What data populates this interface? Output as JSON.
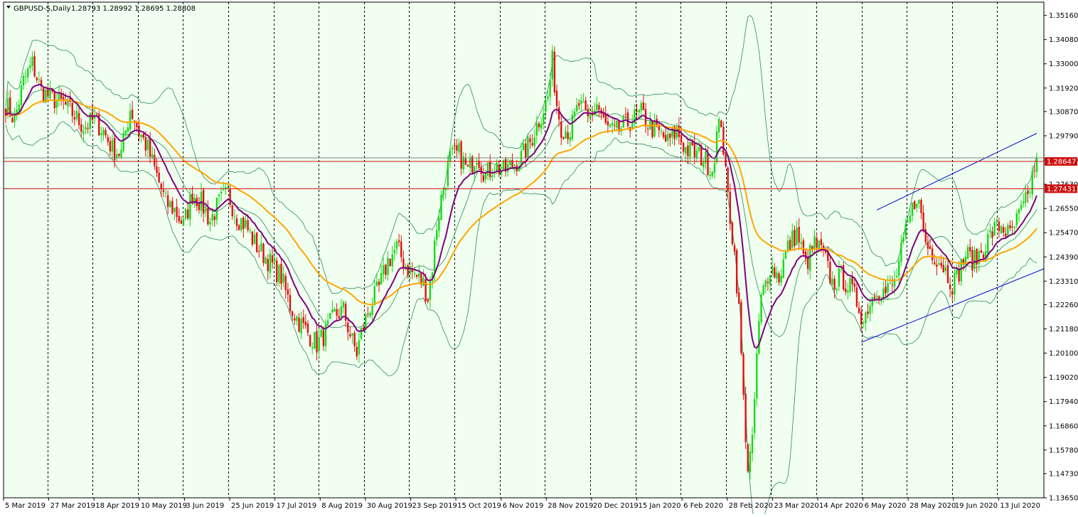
{
  "header": {
    "symbol_label": "GBPUSD-S,Daily",
    "ohlc": "1.28793 1.28992 1.28695 1.28808"
  },
  "colors": {
    "background": "#f0fff0",
    "frame": "#000000",
    "grid": "#000000",
    "bull": "#19d619",
    "bear": "#e01010",
    "ma_fast": "#800080",
    "ma_slow": "#ffa500",
    "bollinger": "#2e8b57",
    "channel": "#0000cc",
    "level_line": "#d01010",
    "last_line": "#808080"
  },
  "chart_data": {
    "type": "candlestick",
    "title": "GBPUSD-S,Daily",
    "timeframe": "Daily",
    "ylim": [
      1.1365,
      1.3575
    ],
    "y_ticks": [
      "1.35160",
      "1.34080",
      "1.33000",
      "1.31920",
      "1.30870",
      "1.29790",
      "1.28710",
      "1.27630",
      "1.26550",
      "1.25470",
      "1.24390",
      "1.23310",
      "1.22260",
      "1.21180",
      "1.20100",
      "1.19020",
      "1.17940",
      "1.16860",
      "1.15780",
      "1.14730",
      "1.13650"
    ],
    "x_labels": [
      "5 Mar 2019",
      "27 Mar 2019",
      "18 Apr 2019",
      "10 May 2019",
      "3 Jun 2019",
      "25 Jun 2019",
      "17 Jul 2019",
      "8 Aug 2019",
      "30 Aug 2019",
      "23 Sep 2019",
      "15 Oct 2019",
      "6 Nov 2019",
      "28 Nov 2019",
      "20 Dec 2019",
      "15 Jan 2020",
      "6 Feb 2020",
      "28 Feb 2020",
      "23 Mar 2020",
      "14 Apr 2020",
      "6 May 2020",
      "28 May 2020",
      "19 Jun 2020",
      "13 Jul 2020"
    ],
    "price_levels": [
      {
        "label": "1.28647",
        "value": 1.28647
      },
      {
        "label": "1.27431",
        "value": 1.27431
      }
    ],
    "last_price": 1.28808,
    "close_path": [
      [
        0,
        1.312
      ],
      [
        4,
        1.305
      ],
      [
        8,
        1.322
      ],
      [
        12,
        1.33
      ],
      [
        16,
        1.318
      ],
      [
        20,
        1.315
      ],
      [
        26,
        1.312
      ],
      [
        30,
        1.308
      ],
      [
        35,
        1.302
      ],
      [
        40,
        1.305
      ],
      [
        44,
        1.3
      ],
      [
        48,
        1.292
      ],
      [
        52,
        1.29
      ],
      [
        56,
        1.31
      ],
      [
        60,
        1.3
      ],
      [
        64,
        1.292
      ],
      [
        68,
        1.28
      ],
      [
        72,
        1.268
      ],
      [
        76,
        1.265
      ],
      [
        80,
        1.258
      ],
      [
        84,
        1.272
      ],
      [
        88,
        1.268
      ],
      [
        92,
        1.26
      ],
      [
        96,
        1.268
      ],
      [
        100,
        1.272
      ],
      [
        104,
        1.262
      ],
      [
        108,
        1.258
      ],
      [
        112,
        1.25
      ],
      [
        116,
        1.245
      ],
      [
        120,
        1.24
      ],
      [
        124,
        1.235
      ],
      [
        128,
        1.222
      ],
      [
        132,
        1.215
      ],
      [
        136,
        1.21
      ],
      [
        140,
        1.205
      ],
      [
        144,
        1.21
      ],
      [
        148,
        1.218
      ],
      [
        152,
        1.22
      ],
      [
        156,
        1.206
      ],
      [
        158,
        1.201
      ],
      [
        160,
        1.21
      ],
      [
        164,
        1.222
      ],
      [
        168,
        1.23
      ],
      [
        172,
        1.242
      ],
      [
        176,
        1.248
      ],
      [
        180,
        1.24
      ],
      [
        184,
        1.236
      ],
      [
        188,
        1.232
      ],
      [
        190,
        1.226
      ],
      [
        192,
        1.24
      ],
      [
        194,
        1.258
      ],
      [
        196,
        1.27
      ],
      [
        200,
        1.288
      ],
      [
        204,
        1.29
      ],
      [
        208,
        1.282
      ],
      [
        212,
        1.29
      ],
      [
        216,
        1.28
      ],
      [
        220,
        1.285
      ],
      [
        224,
        1.282
      ],
      [
        228,
        1.285
      ],
      [
        232,
        1.288
      ],
      [
        236,
        1.295
      ],
      [
        240,
        1.305
      ],
      [
        244,
        1.315
      ],
      [
        246,
        1.331
      ],
      [
        248,
        1.312
      ],
      [
        250,
        1.302
      ],
      [
        254,
        1.3
      ],
      [
        258,
        1.312
      ],
      [
        262,
        1.305
      ],
      [
        266,
        1.312
      ],
      [
        270,
        1.302
      ],
      [
        274,
        1.299
      ],
      [
        278,
        1.302
      ],
      [
        282,
        1.305
      ],
      [
        286,
        1.308
      ],
      [
        290,
        1.302
      ],
      [
        294,
        1.299
      ],
      [
        298,
        1.295
      ],
      [
        302,
        1.3
      ],
      [
        306,
        1.292
      ],
      [
        310,
        1.29
      ],
      [
        314,
        1.288
      ],
      [
        318,
        1.283
      ],
      [
        320,
        1.298
      ],
      [
        322,
        1.305
      ],
      [
        324,
        1.28
      ],
      [
        326,
        1.262
      ],
      [
        328,
        1.245
      ],
      [
        330,
        1.22
      ],
      [
        332,
        1.18
      ],
      [
        334,
        1.15
      ],
      [
        336,
        1.16
      ],
      [
        338,
        1.2
      ],
      [
        340,
        1.225
      ],
      [
        344,
        1.24
      ],
      [
        348,
        1.235
      ],
      [
        352,
        1.248
      ],
      [
        356,
        1.255
      ],
      [
        360,
        1.24
      ],
      [
        364,
        1.25
      ],
      [
        368,
        1.245
      ],
      [
        372,
        1.232
      ],
      [
        376,
        1.235
      ],
      [
        380,
        1.23
      ],
      [
        384,
        1.222
      ],
      [
        386,
        1.215
      ],
      [
        388,
        1.222
      ],
      [
        392,
        1.23
      ],
      [
        396,
        1.228
      ],
      [
        400,
        1.232
      ],
      [
        404,
        1.25
      ],
      [
        408,
        1.265
      ],
      [
        410,
        1.272
      ],
      [
        412,
        1.262
      ],
      [
        414,
        1.25
      ],
      [
        418,
        1.245
      ],
      [
        422,
        1.24
      ],
      [
        426,
        1.232
      ],
      [
        428,
        1.235
      ],
      [
        432,
        1.245
      ],
      [
        436,
        1.242
      ],
      [
        440,
        1.248
      ],
      [
        444,
        1.255
      ],
      [
        448,
        1.258
      ],
      [
        452,
        1.253
      ],
      [
        456,
        1.262
      ],
      [
        460,
        1.27
      ],
      [
        462,
        1.28
      ],
      [
        464,
        1.288
      ]
    ]
  }
}
